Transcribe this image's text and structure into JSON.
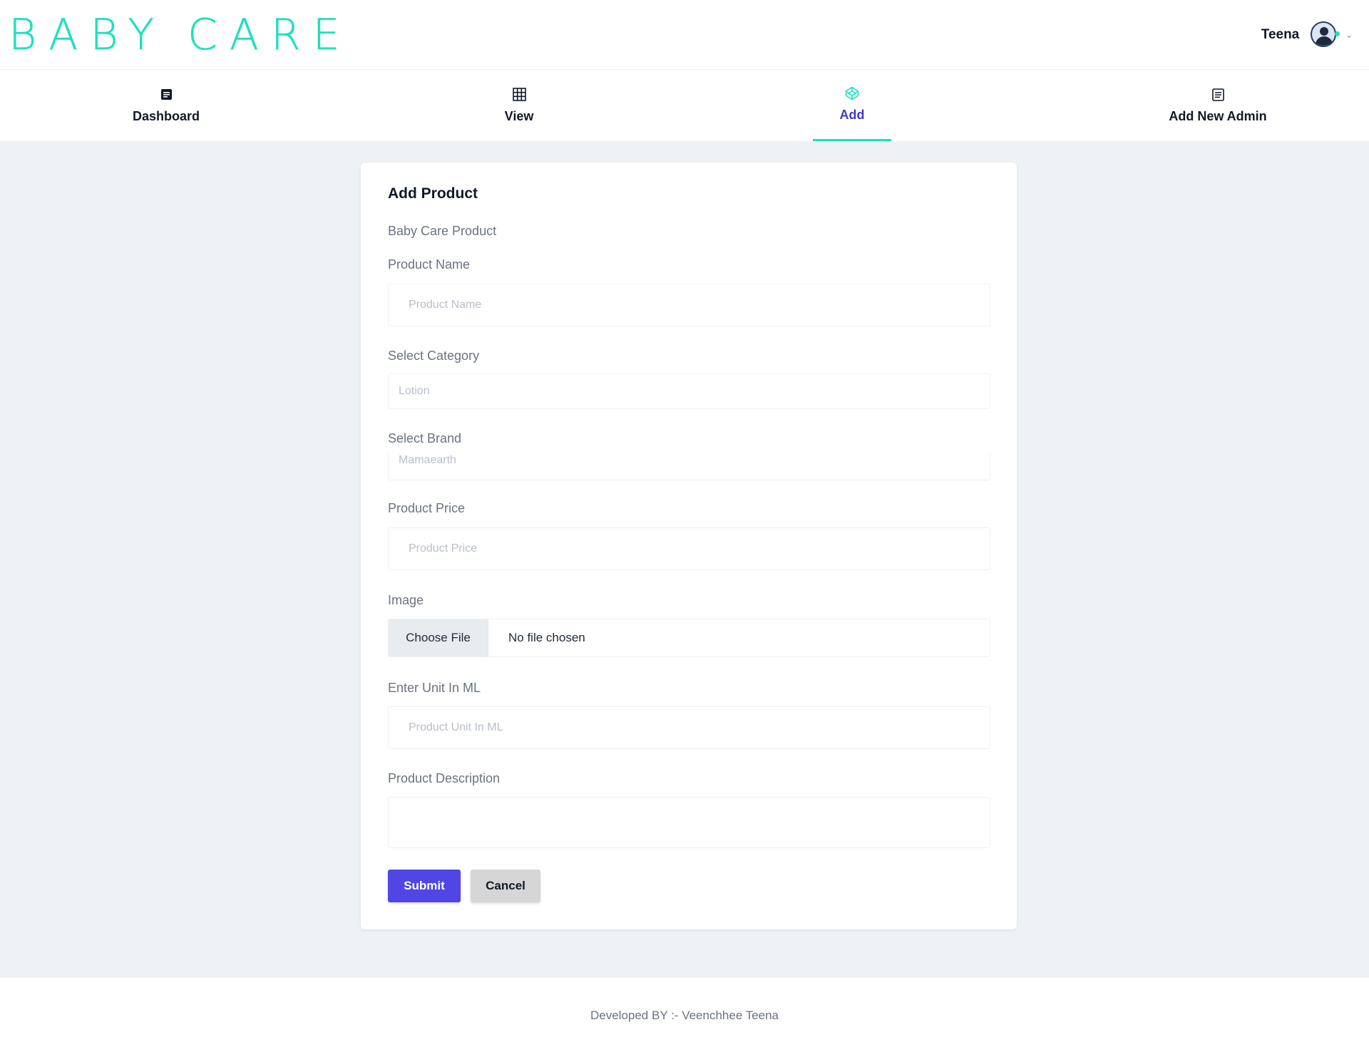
{
  "header": {
    "logo_word1": "BABY",
    "logo_word2": "CARE",
    "user_name": "Teena",
    "colors": {
      "accent": "#1de0c0",
      "primary": "#4f46e5"
    }
  },
  "nav": {
    "items": [
      {
        "label": "Dashboard",
        "icon": "document-icon",
        "active": false
      },
      {
        "label": "View",
        "icon": "grid-icon",
        "active": false
      },
      {
        "label": "Add",
        "icon": "codepen-icon",
        "active": true
      },
      {
        "label": "Add New Admin",
        "icon": "list-icon",
        "active": false
      }
    ]
  },
  "form": {
    "title": "Add Product",
    "subtitle": "Baby Care Product",
    "product_name": {
      "label": "Product Name",
      "placeholder": "Product Name",
      "value": ""
    },
    "category": {
      "label": "Select Category",
      "selected": "Lotion"
    },
    "brand": {
      "label": "Select Brand",
      "selected": "Mamaearth"
    },
    "price": {
      "label": "Product Price",
      "placeholder": "Product Price",
      "value": ""
    },
    "image": {
      "label": "Image",
      "button": "Choose File",
      "status": "No file chosen"
    },
    "unit": {
      "label": "Enter Unit In ML",
      "placeholder": "Product Unit In ML",
      "value": ""
    },
    "description": {
      "label": "Product Description",
      "value": ""
    },
    "submit_label": "Submit",
    "cancel_label": "Cancel"
  },
  "footer": {
    "text": "Developed BY :- Veenchhee Teena"
  }
}
